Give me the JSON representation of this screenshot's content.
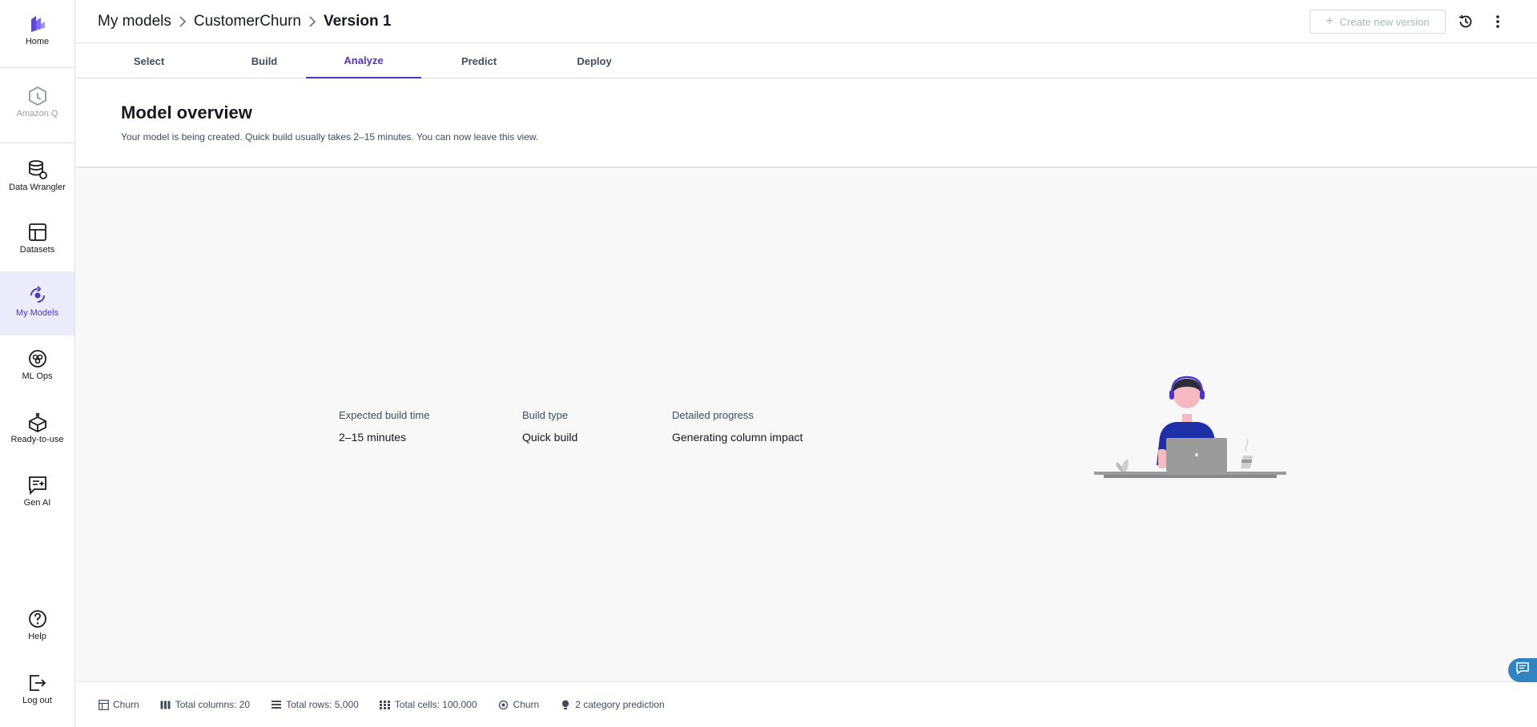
{
  "sidebar": {
    "items": [
      {
        "label": "Home",
        "icon": "canvas-logo-icon"
      },
      {
        "label": "Amazon Q",
        "icon": "amazon-q-icon"
      },
      {
        "label": "Data Wrangler",
        "icon": "data-wrangler-icon"
      },
      {
        "label": "Datasets",
        "icon": "datasets-icon"
      },
      {
        "label": "My Models",
        "icon": "my-models-icon"
      },
      {
        "label": "ML Ops",
        "icon": "ml-ops-icon"
      },
      {
        "label": "Ready-to-use",
        "icon": "ready-to-use-icon"
      },
      {
        "label": "Gen AI",
        "icon": "gen-ai-icon"
      },
      {
        "label": "Help",
        "icon": "help-icon"
      },
      {
        "label": "Log out",
        "icon": "logout-icon"
      }
    ]
  },
  "header": {
    "breadcrumbs": [
      "My models",
      "CustomerChurn",
      "Version 1"
    ],
    "create_version_label": "Create new version"
  },
  "tabs": [
    "Select",
    "Build",
    "Analyze",
    "Predict",
    "Deploy"
  ],
  "active_tab": "Analyze",
  "overview": {
    "title": "Model overview",
    "subtitle": "Your model is being created. Quick build usually takes 2–15 minutes. You can now leave this view."
  },
  "stats": [
    {
      "label": "Expected build time",
      "value": "2–15 minutes"
    },
    {
      "label": "Build type",
      "value": "Quick build"
    },
    {
      "label": "Detailed progress",
      "value": "Generating column impact"
    }
  ],
  "footer": {
    "dataset": "Churn",
    "columns": "Total columns: 20",
    "rows": "Total rows: 5,000",
    "cells": "Total cells: 100,000",
    "target": "Churn",
    "prediction_type": "2 category prediction"
  },
  "colors": {
    "accent": "#4b36c9",
    "active_bg": "#ecebfb",
    "shirt": "#1f2fa8",
    "chat": "#3184c2"
  }
}
